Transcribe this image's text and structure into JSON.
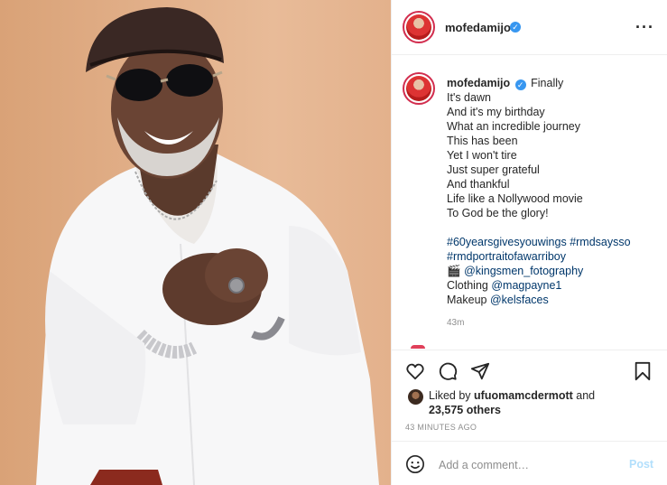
{
  "post": {
    "author": "mofedamijo",
    "image_alt": "Smiling man in white shirt, leather cap and aviator sunglasses"
  },
  "header": {
    "username": "mofedamijo",
    "verified_icon": "verified-badge-icon",
    "more_icon": "more-options-icon"
  },
  "caption": {
    "username": "mofedamijo",
    "lines": [
      "Finally",
      "It's dawn",
      "And it's my birthday",
      "What an incredible journey",
      "This has been",
      "Yet I won't tire",
      "Just super grateful",
      "And thankful",
      "Life like a Nollywood movie",
      "To God be the glory!"
    ],
    "hashtag_line1": "#60yearsgivesyouwings #rmdsaysso",
    "hashtag_line2": "#rmdportraitofawarriboy",
    "photo_credit_emoji": "🎬",
    "photo_credit": "@kingsmen_fotography",
    "clothing_label": "Clothing",
    "clothing_tag": "@magpayne1",
    "makeup_label": "Makeup",
    "makeup_tag": "@kelsfaces",
    "relative_time": "43m"
  },
  "actions": {
    "like_icon": "heart-icon",
    "comment_icon": "comment-icon",
    "share_icon": "share-icon",
    "save_icon": "bookmark-icon"
  },
  "likes": {
    "prefix": "Liked by",
    "user": "ufuomamcdermott",
    "and": "and",
    "others": "23,575 others"
  },
  "timestamp": "43 MINUTES AGO",
  "comment": {
    "emoji_icon": "emoji-icon",
    "placeholder": "Add a comment…",
    "post_label": "Post"
  },
  "colors": {
    "link": "#00376b",
    "verified": "#3897f0",
    "post_button_disabled": "#b2dffc",
    "story_ring": "#d22d4e"
  }
}
